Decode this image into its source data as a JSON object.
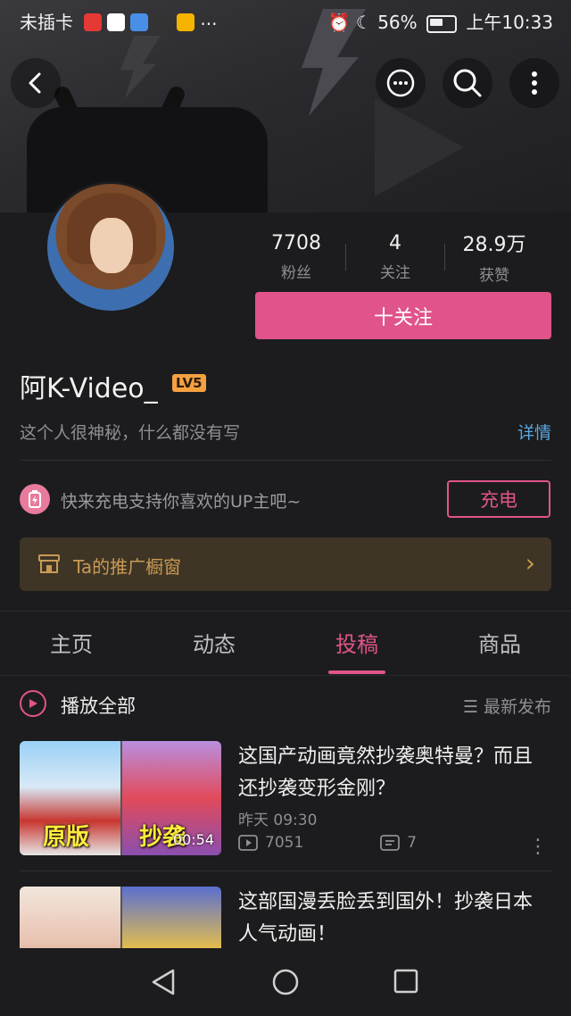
{
  "status": {
    "carrier": "未插卡",
    "battery": "56%",
    "time": "上午10:33"
  },
  "profile": {
    "followers_count": "7708",
    "followers_label": "粉丝",
    "following_count": "4",
    "following_label": "关注",
    "likes_count": "28.9万",
    "likes_label": "获赞",
    "follow_button": "十关注",
    "username": "阿K-Video_",
    "level": "LV5",
    "bio": "这个人很神秘，什么都没有写",
    "detail_link": "详情"
  },
  "charge": {
    "text": "快来充电支持你喜欢的UP主吧~",
    "button": "充电"
  },
  "shop": {
    "label": "Ta的推广橱窗"
  },
  "tabs": [
    {
      "label": "主页"
    },
    {
      "label": "动态"
    },
    {
      "label": "投稿"
    },
    {
      "label": "商品"
    }
  ],
  "list_header": {
    "play_all": "播放全部",
    "sort": "最新发布"
  },
  "videos": [
    {
      "title": "这国产动画竟然抄袭奥特曼？而且还抄袭变形金刚？",
      "date": "昨天 09:30",
      "views": "7051",
      "comments": "7",
      "duration": "00:54",
      "cap_left": "原版",
      "cap_right": "抄袭"
    },
    {
      "title": "这部国漫丢脸丢到国外！抄袭日本人气动画！"
    }
  ],
  "colors": {
    "accent": "#e0548b",
    "link": "#5aa7e0",
    "shop": "#c99a54"
  }
}
